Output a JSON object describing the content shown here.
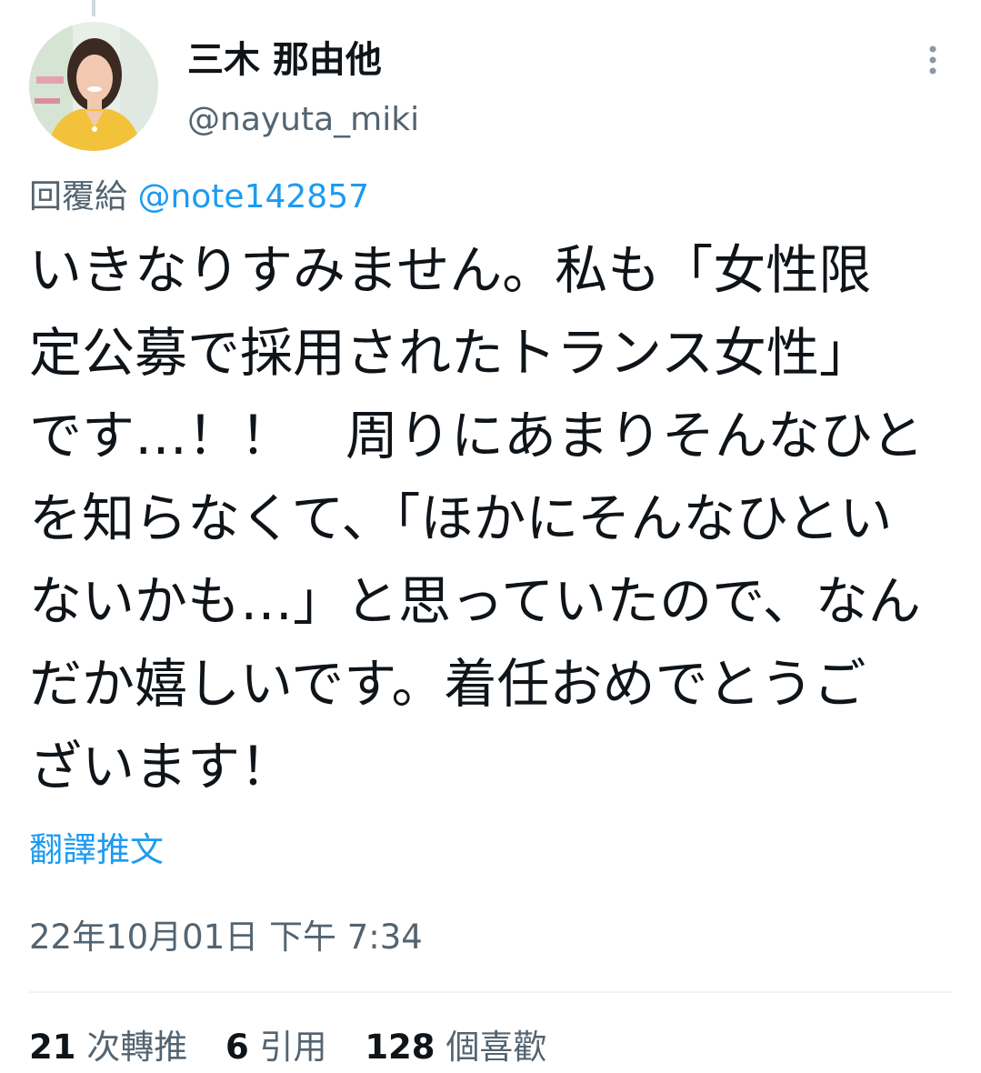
{
  "user": {
    "display_name": "三木 那由他",
    "handle": "@nayuta_miki",
    "avatar_icon": "avatar-photo-icon"
  },
  "reply": {
    "prefix": "回覆給",
    "mention": "@note142857"
  },
  "tweet": {
    "lines": [
      "いきなりすみません。私も「女性限",
      "定公募で採用されたトランス女性」",
      "です…！！　周りにあまりそんなひと",
      "を知らなくて、「ほかにそんなひとい",
      "ないかも…」と思っていたので、なん",
      "だか嬉しいです。着任おめでとうご",
      "ざいます！"
    ]
  },
  "translate_label": "翻譯推文",
  "timestamp": "22年10月01日 下午 7:34",
  "stats": {
    "retweets": {
      "count": "21",
      "label": "次轉推"
    },
    "quotes": {
      "count": "6",
      "label": "引用"
    },
    "likes": {
      "count": "128",
      "label": "個喜歡"
    }
  },
  "colors": {
    "text": "#0f1419",
    "secondary": "#536471",
    "link": "#1d9bf0",
    "divider": "#eff3f4"
  },
  "icons": {
    "more": "more-vertical-icon"
  }
}
